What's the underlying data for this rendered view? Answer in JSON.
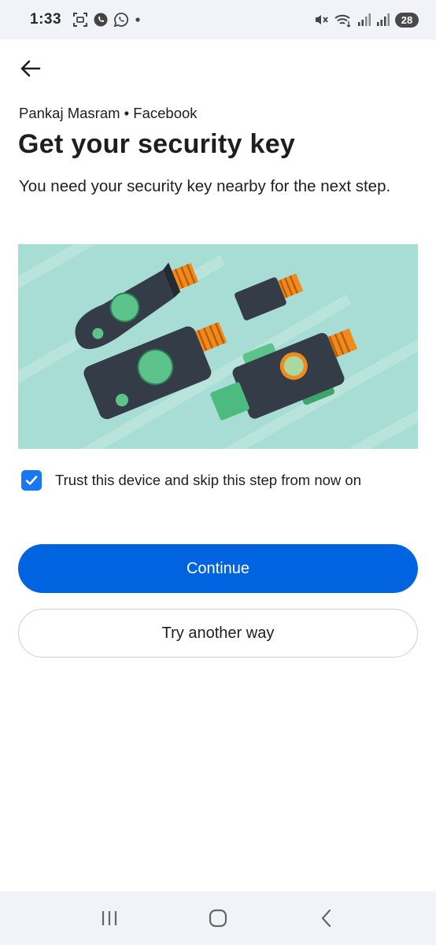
{
  "status_bar": {
    "time": "1:33",
    "left_icons": [
      "screenshot-icon",
      "viber-icon",
      "whatsapp-icon",
      "dot-icon"
    ],
    "right_icons": [
      "mute-icon",
      "wifi-icon",
      "signal-icon",
      "signal-icon"
    ],
    "battery": "28"
  },
  "header": {
    "back_icon": "arrow-left-icon",
    "account_line": "Pankaj Masram • Facebook",
    "title": "Get your security key",
    "subtitle": "You need your security key nearby for the next step."
  },
  "hero": {
    "background_color": "#a8ddd5",
    "key_body_color": "#343c47",
    "connector_color": "#f08a1c",
    "button_color": "#5cc48a"
  },
  "trust": {
    "checked": true,
    "label": "Trust this device and skip this step from now on"
  },
  "buttons": {
    "continue_label": "Continue",
    "another_way_label": "Try another way"
  },
  "nav_bar": {
    "icons": [
      "recents-icon",
      "home-icon",
      "back-icon"
    ]
  },
  "colors": {
    "primary": "#0064e0",
    "checkbox": "#1877f2"
  }
}
